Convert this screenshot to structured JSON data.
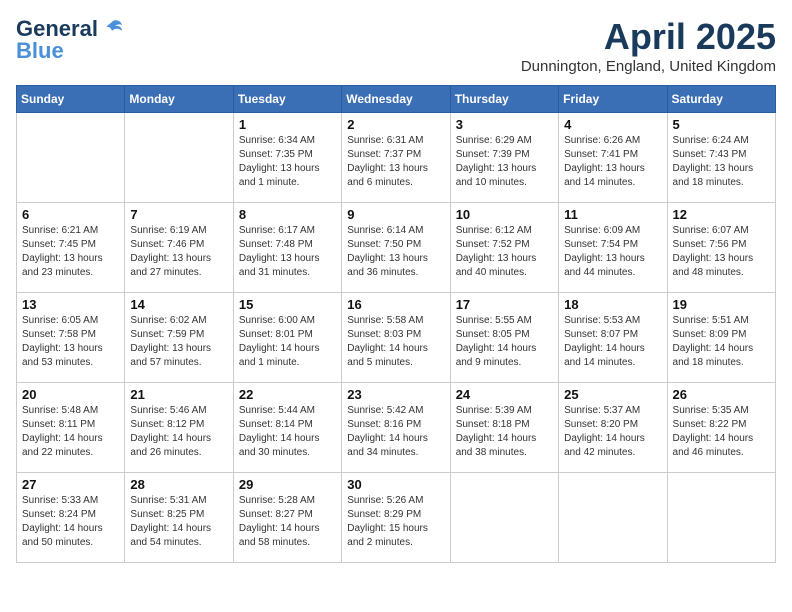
{
  "header": {
    "logo_general": "General",
    "logo_blue": "Blue",
    "title": "April 2025",
    "subtitle": "Dunnington, England, United Kingdom"
  },
  "weekdays": [
    "Sunday",
    "Monday",
    "Tuesday",
    "Wednesday",
    "Thursday",
    "Friday",
    "Saturday"
  ],
  "weeks": [
    [
      {
        "day": "",
        "info": ""
      },
      {
        "day": "",
        "info": ""
      },
      {
        "day": "1",
        "info": "Sunrise: 6:34 AM\nSunset: 7:35 PM\nDaylight: 13 hours and 1 minute."
      },
      {
        "day": "2",
        "info": "Sunrise: 6:31 AM\nSunset: 7:37 PM\nDaylight: 13 hours and 6 minutes."
      },
      {
        "day": "3",
        "info": "Sunrise: 6:29 AM\nSunset: 7:39 PM\nDaylight: 13 hours and 10 minutes."
      },
      {
        "day": "4",
        "info": "Sunrise: 6:26 AM\nSunset: 7:41 PM\nDaylight: 13 hours and 14 minutes."
      },
      {
        "day": "5",
        "info": "Sunrise: 6:24 AM\nSunset: 7:43 PM\nDaylight: 13 hours and 18 minutes."
      }
    ],
    [
      {
        "day": "6",
        "info": "Sunrise: 6:21 AM\nSunset: 7:45 PM\nDaylight: 13 hours and 23 minutes."
      },
      {
        "day": "7",
        "info": "Sunrise: 6:19 AM\nSunset: 7:46 PM\nDaylight: 13 hours and 27 minutes."
      },
      {
        "day": "8",
        "info": "Sunrise: 6:17 AM\nSunset: 7:48 PM\nDaylight: 13 hours and 31 minutes."
      },
      {
        "day": "9",
        "info": "Sunrise: 6:14 AM\nSunset: 7:50 PM\nDaylight: 13 hours and 36 minutes."
      },
      {
        "day": "10",
        "info": "Sunrise: 6:12 AM\nSunset: 7:52 PM\nDaylight: 13 hours and 40 minutes."
      },
      {
        "day": "11",
        "info": "Sunrise: 6:09 AM\nSunset: 7:54 PM\nDaylight: 13 hours and 44 minutes."
      },
      {
        "day": "12",
        "info": "Sunrise: 6:07 AM\nSunset: 7:56 PM\nDaylight: 13 hours and 48 minutes."
      }
    ],
    [
      {
        "day": "13",
        "info": "Sunrise: 6:05 AM\nSunset: 7:58 PM\nDaylight: 13 hours and 53 minutes."
      },
      {
        "day": "14",
        "info": "Sunrise: 6:02 AM\nSunset: 7:59 PM\nDaylight: 13 hours and 57 minutes."
      },
      {
        "day": "15",
        "info": "Sunrise: 6:00 AM\nSunset: 8:01 PM\nDaylight: 14 hours and 1 minute."
      },
      {
        "day": "16",
        "info": "Sunrise: 5:58 AM\nSunset: 8:03 PM\nDaylight: 14 hours and 5 minutes."
      },
      {
        "day": "17",
        "info": "Sunrise: 5:55 AM\nSunset: 8:05 PM\nDaylight: 14 hours and 9 minutes."
      },
      {
        "day": "18",
        "info": "Sunrise: 5:53 AM\nSunset: 8:07 PM\nDaylight: 14 hours and 14 minutes."
      },
      {
        "day": "19",
        "info": "Sunrise: 5:51 AM\nSunset: 8:09 PM\nDaylight: 14 hours and 18 minutes."
      }
    ],
    [
      {
        "day": "20",
        "info": "Sunrise: 5:48 AM\nSunset: 8:11 PM\nDaylight: 14 hours and 22 minutes."
      },
      {
        "day": "21",
        "info": "Sunrise: 5:46 AM\nSunset: 8:12 PM\nDaylight: 14 hours and 26 minutes."
      },
      {
        "day": "22",
        "info": "Sunrise: 5:44 AM\nSunset: 8:14 PM\nDaylight: 14 hours and 30 minutes."
      },
      {
        "day": "23",
        "info": "Sunrise: 5:42 AM\nSunset: 8:16 PM\nDaylight: 14 hours and 34 minutes."
      },
      {
        "day": "24",
        "info": "Sunrise: 5:39 AM\nSunset: 8:18 PM\nDaylight: 14 hours and 38 minutes."
      },
      {
        "day": "25",
        "info": "Sunrise: 5:37 AM\nSunset: 8:20 PM\nDaylight: 14 hours and 42 minutes."
      },
      {
        "day": "26",
        "info": "Sunrise: 5:35 AM\nSunset: 8:22 PM\nDaylight: 14 hours and 46 minutes."
      }
    ],
    [
      {
        "day": "27",
        "info": "Sunrise: 5:33 AM\nSunset: 8:24 PM\nDaylight: 14 hours and 50 minutes."
      },
      {
        "day": "28",
        "info": "Sunrise: 5:31 AM\nSunset: 8:25 PM\nDaylight: 14 hours and 54 minutes."
      },
      {
        "day": "29",
        "info": "Sunrise: 5:28 AM\nSunset: 8:27 PM\nDaylight: 14 hours and 58 minutes."
      },
      {
        "day": "30",
        "info": "Sunrise: 5:26 AM\nSunset: 8:29 PM\nDaylight: 15 hours and 2 minutes."
      },
      {
        "day": "",
        "info": ""
      },
      {
        "day": "",
        "info": ""
      },
      {
        "day": "",
        "info": ""
      }
    ]
  ]
}
